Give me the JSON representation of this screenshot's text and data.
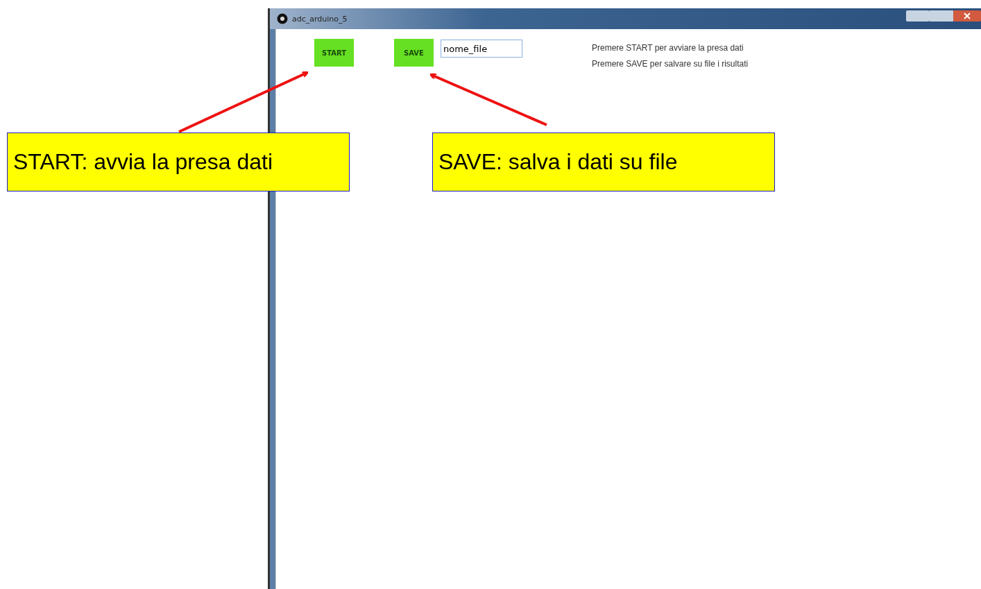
{
  "window": {
    "title": "adc_arduino_5"
  },
  "buttons": [
    {
      "label": "START"
    },
    {
      "label": "SAVE"
    }
  ],
  "file_field": {
    "value": "nome_file"
  },
  "instructions": [
    "Premere START per avviare la presa dati",
    "Premere SAVE per salvare su file i risultati"
  ],
  "callouts": [
    {
      "text": "START: avvia la presa dati"
    },
    {
      "text": "SAVE: salva i dati su file"
    }
  ]
}
